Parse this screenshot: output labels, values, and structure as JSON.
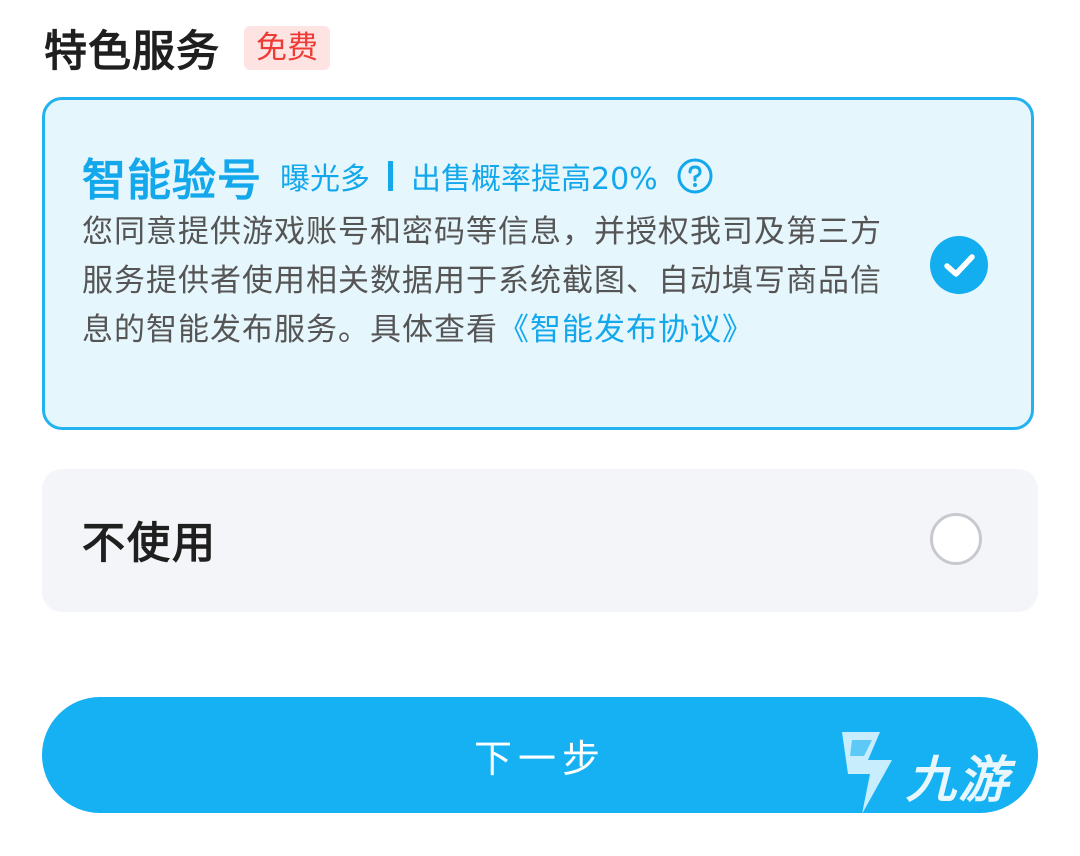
{
  "header": {
    "title": "特色服务",
    "badge": "免费"
  },
  "option_smart": {
    "title": "智能验号",
    "tag_exposure": "曝光多",
    "tag_rate": "出售概率提高20%",
    "description": "您同意提供游戏账号和密码等信息，并授权我司及第三方服务提供者使用相关数据用于系统截图、自动填写商品信息的智能发布服务。具体查看",
    "agreement_link": "《智能发布协议》",
    "selected": true
  },
  "option_none": {
    "label": "不使用",
    "selected": false
  },
  "next_button": {
    "label": "下一步"
  },
  "watermark": {
    "text": "九游"
  },
  "colors": {
    "accent": "#13a8ec",
    "button": "#15b1f3",
    "badge_text": "#ef3b35",
    "badge_bg": "#fde3e2"
  }
}
